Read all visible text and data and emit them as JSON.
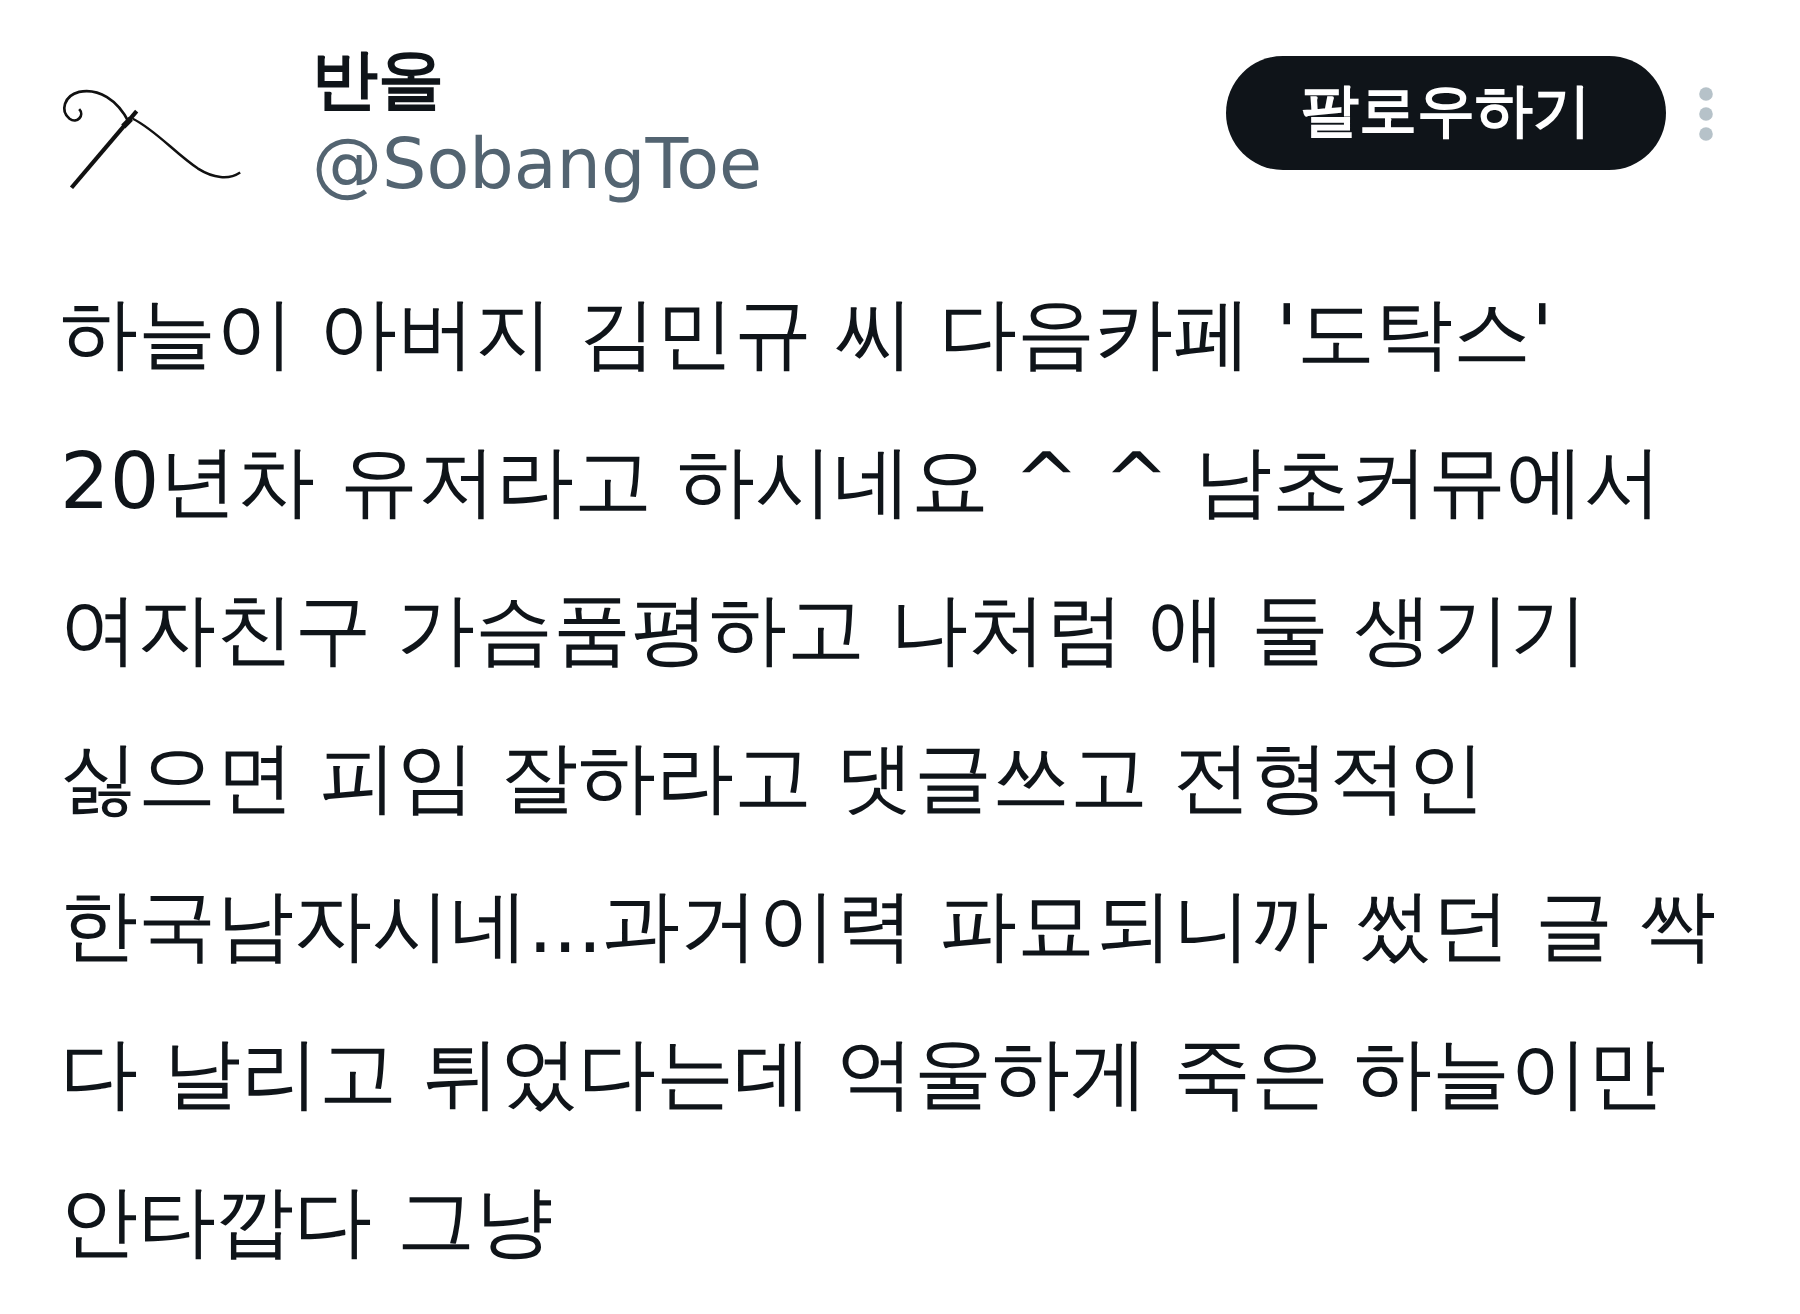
{
  "author": {
    "name": "반올",
    "handle": "@SobangToe"
  },
  "follow_button": {
    "label": "팔로우하기"
  },
  "tweet": {
    "lines": [
      "하늘이 아버지 김민규 씨 다음카페 '도탁스'",
      "20년차 유저라고 하시네요 ^ ^ 남초커뮤에서",
      "여자친구 가슴품평하고 나처럼 애 둘 생기기",
      "싫으면 피임 잘하라고 댓글쓰고 전형적인",
      "한국남자시네...과거이력 파묘되니까 썼던 글 싹",
      "다 날리고 튀었다는데 억울하게 죽은 하늘이만",
      "안타깝다 그냥"
    ]
  }
}
